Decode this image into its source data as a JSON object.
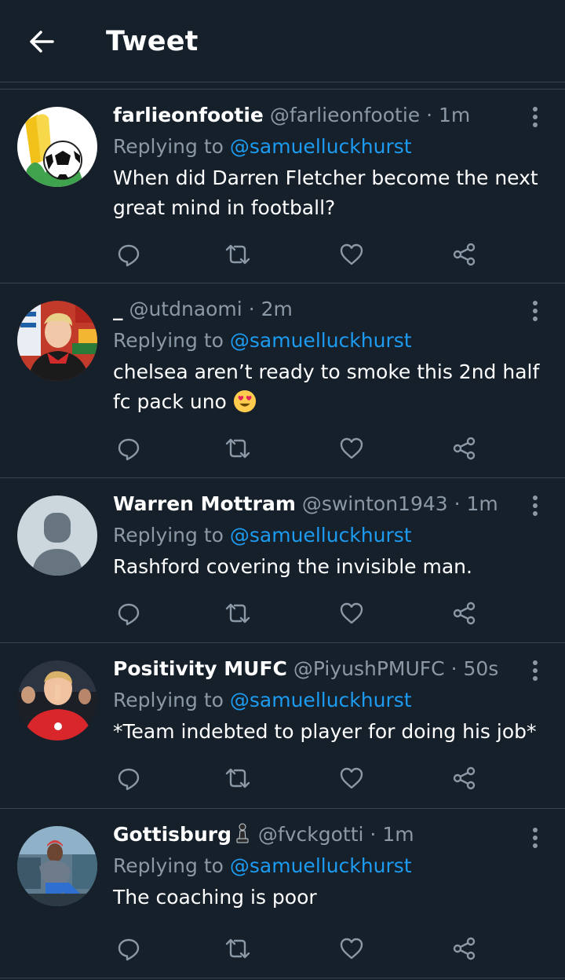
{
  "header": {
    "title": "Tweet"
  },
  "colors": {
    "background": "#15202b",
    "divider": "#38444d",
    "text": "#ffffff",
    "secondary": "#8b98a5",
    "link": "#1d9bf0"
  },
  "tweets": [
    {
      "name": "farlieonfootie",
      "handle": "@farlieonfootie",
      "dot": "·",
      "time": "1m",
      "replying_prefix": "Replying to ",
      "replying_to": "@samuelluckhurst",
      "text": "When did Darren Fletcher become the next great mind in football?",
      "avatar_icon": "football-avatar"
    },
    {
      "name": "_",
      "handle": "@utdnaomi",
      "dot": "·",
      "time": "2m",
      "replying_prefix": "Replying to ",
      "replying_to": "@samuelluckhurst",
      "text": "chelsea aren’t ready to smoke this 2nd half fc pack uno",
      "emoji": "heart-eyes-emoji",
      "avatar_icon": "player-avatar"
    },
    {
      "name": "Warren Mottram",
      "handle": "@swinton1943",
      "dot": "·",
      "time": "1m",
      "replying_prefix": "Replying to ",
      "replying_to": "@samuelluckhurst",
      "text": "Rashford covering the invisible man.",
      "avatar_icon": "default-avatar"
    },
    {
      "name": "Positivity MUFC",
      "handle": "@PiyushPMUFC",
      "dot": "·",
      "time": "50s",
      "replying_prefix": "Replying to ",
      "replying_to": "@samuelluckhurst",
      "text": "*Team indebted to player for doing his job*",
      "avatar_icon": "shush-avatar"
    },
    {
      "name": "Gottisburg",
      "handle": "@fvckgotti",
      "dot": "·",
      "time": "1m",
      "replying_prefix": "Replying to ",
      "replying_to": "@samuelluckhurst",
      "text": "The coaching is poor",
      "name_badge": "chess-pawn-icon",
      "avatar_icon": "photo-avatar"
    }
  ]
}
